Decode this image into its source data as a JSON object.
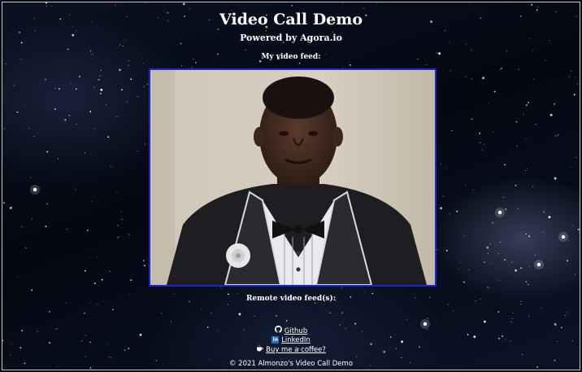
{
  "header": {
    "title": "Video Call Demo",
    "subtitle": "Powered by Agora.io"
  },
  "local": {
    "label": "My video feed:"
  },
  "remote": {
    "label": "Remote video feed(s):"
  },
  "links": {
    "github": {
      "label": "Github",
      "icon": "github-icon"
    },
    "linkedin": {
      "label": "LinkedIn",
      "icon": "linkedin-icon"
    },
    "coffee": {
      "label": "Buy me a coffee?",
      "icon": "coffee-icon"
    }
  },
  "footer": {
    "text": "© 2021 Almonzo's Video Call Demo"
  },
  "colors": {
    "video_border": "#2222dd",
    "text": "#ffffff"
  }
}
